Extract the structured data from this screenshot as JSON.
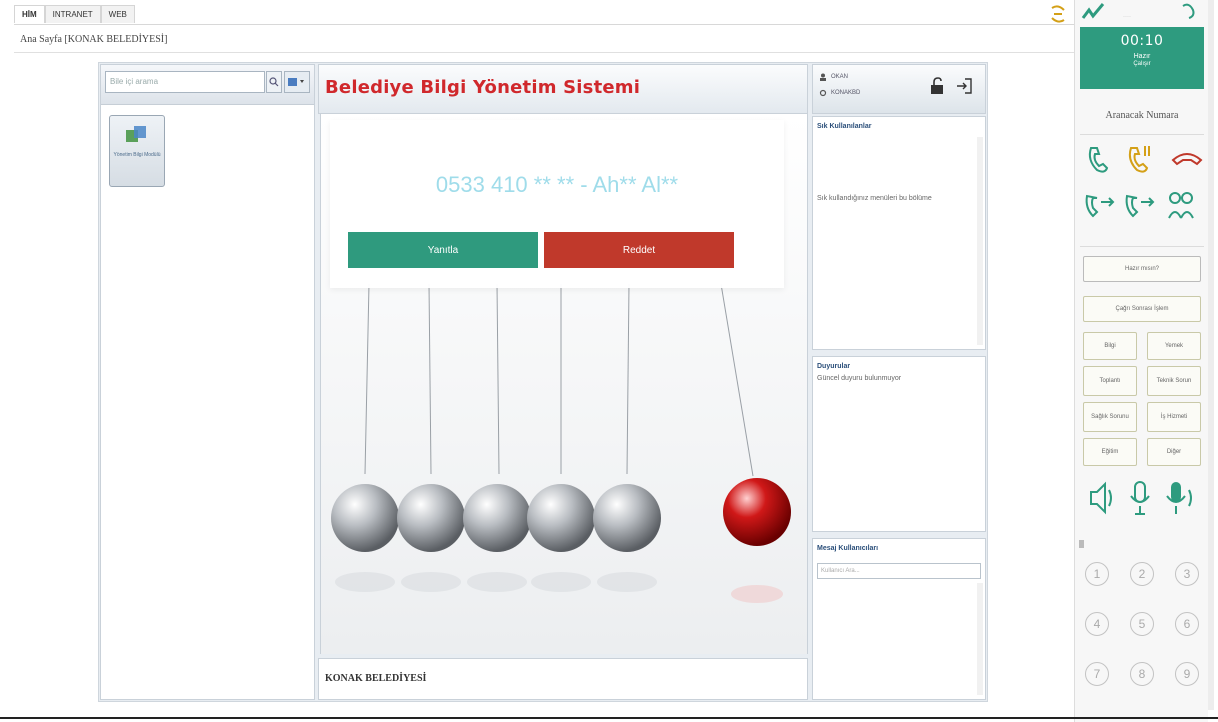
{
  "tabs": [
    "HİM",
    "INTRANET",
    "WEB"
  ],
  "breadcrumb": "Ana Sayfa [KONAK BELEDİYESİ]",
  "left": {
    "search_placeholder": "Bile içi arama",
    "module_label": "Yönetim Bilgi Modülü"
  },
  "center": {
    "title": "Belediye Bilgi Yönetim Sistemi",
    "footer": "KONAK BELEDİYESİ"
  },
  "call": {
    "caller": "0533 410 ** ** - Ah** Al**",
    "answer": "Yanıtla",
    "reject": "Reddet"
  },
  "user": {
    "name": "OKAN",
    "unit": "KONAKBD"
  },
  "panels": {
    "frequent_title": "Sık Kullanılanlar",
    "frequent_text": "Sık kullandığınız menüleri bu bölüme",
    "announcements_title": "Duyurular",
    "announcements_text": "Güncel duyuru bulunmuyor",
    "messages_title": "Mesaj Kullanıcıları",
    "messages_placeholder": "Kullanıcı Ara..."
  },
  "phone": {
    "timer": "00:10",
    "status": "Hazır",
    "substatus": "Çalışır",
    "dial_label": "Aranacak Numara",
    "ready_button": "Hazır mısın?",
    "after_call_button": "Çağrı Sonrası İşlem",
    "buttons": [
      "Bilgi",
      "Yemek",
      "Toplantı",
      "Teknik Sorun",
      "Sağlık Sorunu",
      "İş Hizmeti",
      "Eğitim",
      "Diğer"
    ],
    "keys": [
      "1",
      "2",
      "3",
      "4",
      "5",
      "6",
      "7",
      "8",
      "9"
    ]
  },
  "colors": {
    "accent_green": "#2e9b7f",
    "reject_red": "#c0392b",
    "title_red": "#d0282c",
    "caller_text": "#9fdcea"
  }
}
